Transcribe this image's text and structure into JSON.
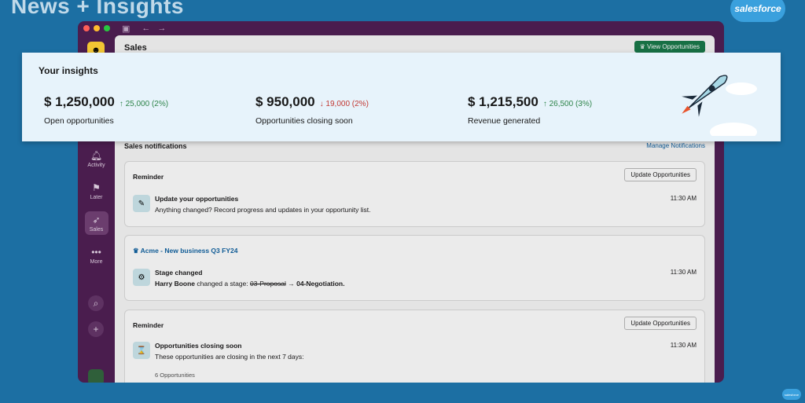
{
  "slide": {
    "title": "News + Insights",
    "logo": "salesforce",
    "logo_small": "salesforce"
  },
  "window": {
    "header": {
      "title": "Sales",
      "view_button": "View Opportunities"
    },
    "rail": {
      "items": [
        {
          "label": "Activity",
          "icon": "bell-icon"
        },
        {
          "label": "Later",
          "icon": "bookmark-icon"
        },
        {
          "label": "Sales",
          "icon": "rocket-icon"
        },
        {
          "label": "More",
          "icon": "ellipsis-icon"
        }
      ]
    },
    "notifications": {
      "title": "Sales notifications",
      "manage_link": "Manage Notifications",
      "cards": [
        {
          "header": "Reminder",
          "button": "Update Opportunities",
          "item_title": "Update your opportunities",
          "item_sub": "Anything changed? Record progress and updates in your opportunity list.",
          "time": "11:30 AM"
        },
        {
          "header": "Acme - New business Q3 FY24",
          "item_title": "Stage changed",
          "item_sub_name": "Harry Boone",
          "item_sub_text": "changed a stage:",
          "from_stage": "03-Proposal",
          "arrow": "→",
          "to_stage": "04-Negotiation.",
          "time": "11:30 AM"
        },
        {
          "header": "Reminder",
          "button": "Update Opportunities",
          "item_title": "Opportunities closing soon",
          "item_sub": "These opportunities are closing in the next 7 days:",
          "time": "11:30 AM",
          "count": "6 Opportunities"
        }
      ]
    }
  },
  "insights": {
    "title": "Your insights",
    "metrics": [
      {
        "value": "$ 1,250,000",
        "delta": "↑ 25,000 (2%)",
        "direction": "up",
        "label": "Open opportunities"
      },
      {
        "value": "$ 950,000",
        "delta": "↓ 19,000 (2%)",
        "direction": "down",
        "label": "Opportunities closing soon"
      },
      {
        "value": "$ 1,215,500",
        "delta": "↑ 26,500 (3%)",
        "direction": "up",
        "label": "Revenue generated"
      }
    ]
  },
  "colors": {
    "up": "#2e844a",
    "down": "#c23934",
    "accent": "#1264a3",
    "window": "#4a1d4e"
  }
}
